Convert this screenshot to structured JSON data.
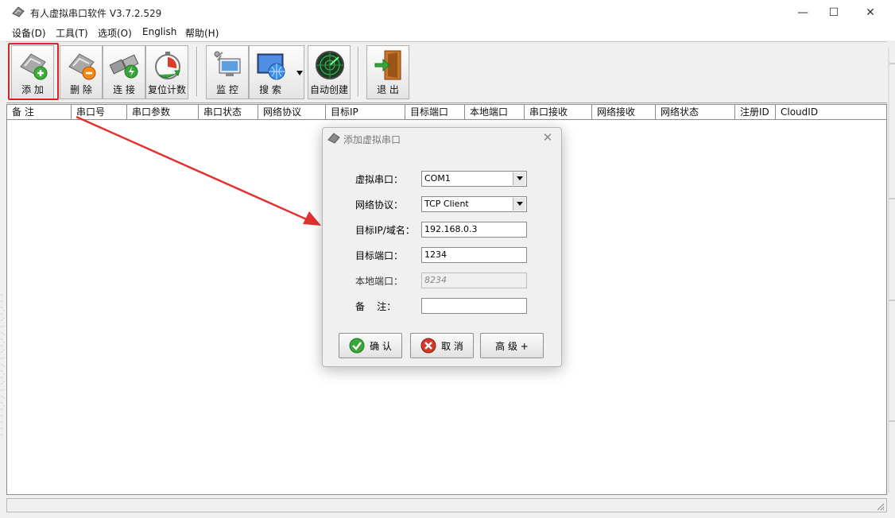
{
  "window": {
    "title": "有人虚拟串口软件 V3.7.2.529",
    "controls": {
      "minimize": "—",
      "maximize": "☐",
      "close": "✕"
    }
  },
  "menu": [
    "设备(D)",
    "工具(T)",
    "选项(O)",
    "English",
    "帮助(H)"
  ],
  "toolbar": {
    "add": "添 加",
    "delete": "删 除",
    "connect": "连 接",
    "reset_count": "复位计数",
    "monitor": "监 控",
    "search": "搜 索",
    "auto_create": "自动创建",
    "exit": "退 出"
  },
  "table": {
    "columns": [
      "备 注",
      "串口号",
      "串口参数",
      "串口状态",
      "网络协议",
      "目标IP",
      "目标端口",
      "本地端口",
      "串口接收",
      "网络接收",
      "网络状态",
      "注册ID",
      "CloudID"
    ],
    "rows": []
  },
  "dialog": {
    "title": "添加虚拟串口",
    "labels": {
      "virtual_port": "虚拟串口：",
      "protocol": "网络协议：",
      "target_ip": "目标IP/域名：",
      "target_port": "目标端口：",
      "local_port": "本地端口：",
      "remark": "备    注："
    },
    "values": {
      "virtual_port": "COM1",
      "protocol": "TCP Client",
      "target_ip": "192.168.0.3",
      "target_port": "1234",
      "local_port": "8234",
      "remark": ""
    },
    "buttons": {
      "ok": "确 认",
      "cancel": "取 消",
      "advanced": "高 级 +"
    }
  },
  "colors": {
    "highlight": "#e02020",
    "arrow": "#e53030",
    "ok_icon": "#3aa53a",
    "cancel_icon": "#d03a2a"
  },
  "icons": {
    "app": "serial-port-icon",
    "add": "serial-port-add-icon",
    "delete": "serial-port-remove-icon",
    "connect": "plug-connect-icon",
    "reset": "stopwatch-icon",
    "monitor": "monitor-icon",
    "search": "globe-search-icon",
    "auto_create": "radar-icon",
    "exit": "exit-door-icon"
  }
}
